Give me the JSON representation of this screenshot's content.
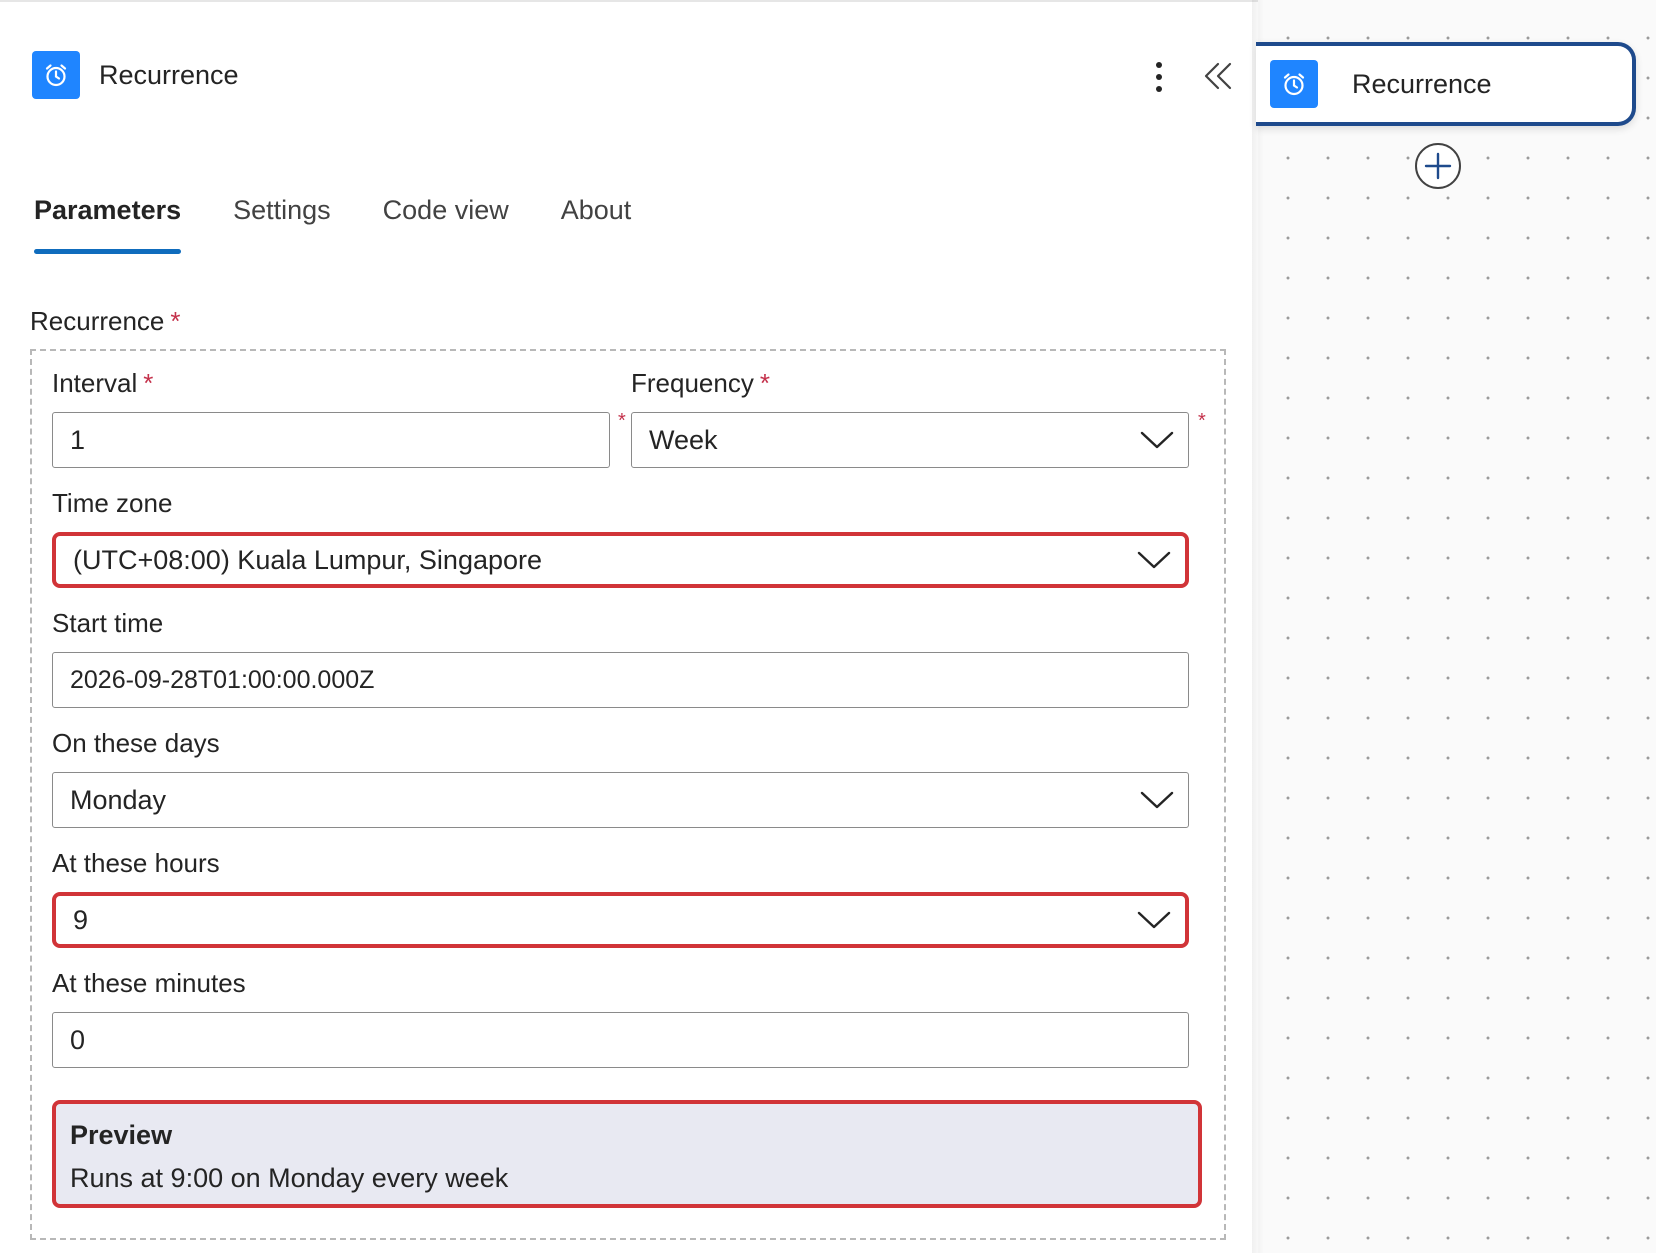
{
  "panel": {
    "title": "Recurrence",
    "tabs": [
      {
        "label": "Parameters",
        "active": true
      },
      {
        "label": "Settings",
        "active": false
      },
      {
        "label": "Code view",
        "active": false
      },
      {
        "label": "About",
        "active": false
      }
    ]
  },
  "form": {
    "section_label": "Recurrence",
    "required_mark": "*",
    "interval": {
      "label": "Interval",
      "value": "1"
    },
    "frequency": {
      "label": "Frequency",
      "value": "Week"
    },
    "time_zone": {
      "label": "Time zone",
      "value": "(UTC+08:00) Kuala Lumpur, Singapore"
    },
    "start_time": {
      "label": "Start time",
      "value": "2026-09-28T01:00:00.000Z"
    },
    "on_these_days": {
      "label": "On these days",
      "value": "Monday"
    },
    "at_these_hours": {
      "label": "At these hours",
      "value": "9"
    },
    "at_these_minutes": {
      "label": "At these minutes",
      "value": "0"
    },
    "preview": {
      "title": "Preview",
      "text": "Runs at 9:00 on Monday every week"
    }
  },
  "canvas": {
    "node_title": "Recurrence"
  },
  "icons": {
    "trigger": "alarm-clock-icon",
    "more": "more-vertical-icon",
    "collapse": "chevron-double-left-icon",
    "dropdown": "chevron-down-icon",
    "add": "plus-circle-icon"
  },
  "colors": {
    "accent": "#0f6cbd",
    "icon_bg": "#1f85ff",
    "highlight": "#d13438",
    "required": "#c4314b",
    "preview_bg": "#e8e9f2",
    "node_border": "#1e4a8c"
  }
}
